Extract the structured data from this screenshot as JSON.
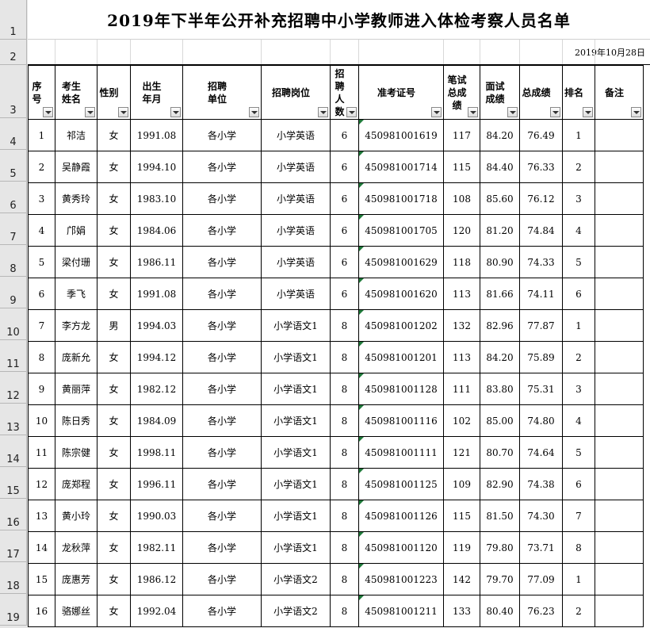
{
  "title": "2019年下半年公开补充招聘中小学教师进入体检考察人员名单",
  "date": "2019年10月28日",
  "row_numbers": [
    "1",
    "2",
    "3",
    "4",
    "5",
    "6",
    "7",
    "8",
    "9",
    "10",
    "11",
    "12",
    "13",
    "14",
    "15",
    "16",
    "17",
    "18",
    "19"
  ],
  "headers": [
    {
      "key": "seq",
      "label": "序\n号"
    },
    {
      "key": "name",
      "label": "考生\n姓名"
    },
    {
      "key": "gender",
      "label": "性别"
    },
    {
      "key": "birth",
      "label": "出生\n年月"
    },
    {
      "key": "unit",
      "label": "招聘\n单位"
    },
    {
      "key": "post",
      "label": "招聘岗位"
    },
    {
      "key": "count",
      "label": "招聘\n人数"
    },
    {
      "key": "exam_id",
      "label": "准考证号"
    },
    {
      "key": "written",
      "label": "笔试\n总成\n绩"
    },
    {
      "key": "interview",
      "label": "面试\n成绩"
    },
    {
      "key": "total",
      "label": "总成绩"
    },
    {
      "key": "rank",
      "label": "排名"
    },
    {
      "key": "note",
      "label": "备注"
    }
  ],
  "rows": [
    [
      "1",
      "祁洁",
      "女",
      "1991.08",
      "各小学",
      "小学英语",
      "6",
      "450981001619",
      "117",
      "84.20",
      "76.49",
      "1",
      ""
    ],
    [
      "2",
      "吴静霞",
      "女",
      "1994.10",
      "各小学",
      "小学英语",
      "6",
      "450981001714",
      "115",
      "84.40",
      "76.33",
      "2",
      ""
    ],
    [
      "3",
      "黄秀玲",
      "女",
      "1983.10",
      "各小学",
      "小学英语",
      "6",
      "450981001718",
      "108",
      "85.60",
      "76.12",
      "3",
      ""
    ],
    [
      "4",
      "邝娟",
      "女",
      "1984.06",
      "各小学",
      "小学英语",
      "6",
      "450981001705",
      "120",
      "81.20",
      "74.84",
      "4",
      ""
    ],
    [
      "5",
      "梁付珊",
      "女",
      "1986.11",
      "各小学",
      "小学英语",
      "6",
      "450981001629",
      "118",
      "80.90",
      "74.33",
      "5",
      ""
    ],
    [
      "6",
      "季飞",
      "女",
      "1991.08",
      "各小学",
      "小学英语",
      "6",
      "450981001620",
      "113",
      "81.66",
      "74.11",
      "6",
      ""
    ],
    [
      "7",
      "李方龙",
      "男",
      "1994.03",
      "各小学",
      "小学语文1",
      "8",
      "450981001202",
      "132",
      "82.96",
      "77.87",
      "1",
      ""
    ],
    [
      "8",
      "庞新允",
      "女",
      "1994.12",
      "各小学",
      "小学语文1",
      "8",
      "450981001201",
      "113",
      "84.20",
      "75.89",
      "2",
      ""
    ],
    [
      "9",
      "黄丽萍",
      "女",
      "1982.12",
      "各小学",
      "小学语文1",
      "8",
      "450981001128",
      "111",
      "83.80",
      "75.31",
      "3",
      ""
    ],
    [
      "10",
      "陈日秀",
      "女",
      "1984.09",
      "各小学",
      "小学语文1",
      "8",
      "450981001116",
      "102",
      "85.00",
      "74.80",
      "4",
      ""
    ],
    [
      "11",
      "陈宗健",
      "女",
      "1998.11",
      "各小学",
      "小学语文1",
      "8",
      "450981001111",
      "121",
      "80.70",
      "74.64",
      "5",
      ""
    ],
    [
      "12",
      "庞郑程",
      "女",
      "1996.11",
      "各小学",
      "小学语文1",
      "8",
      "450981001125",
      "109",
      "82.90",
      "74.38",
      "6",
      ""
    ],
    [
      "13",
      "黄小玲",
      "女",
      "1990.03",
      "各小学",
      "小学语文1",
      "8",
      "450981001126",
      "115",
      "81.50",
      "74.30",
      "7",
      ""
    ],
    [
      "14",
      "龙秋萍",
      "女",
      "1982.11",
      "各小学",
      "小学语文1",
      "8",
      "450981001120",
      "119",
      "79.80",
      "73.71",
      "8",
      ""
    ],
    [
      "15",
      "庞惠芳",
      "女",
      "1986.12",
      "各小学",
      "小学语文2",
      "8",
      "450981001223",
      "142",
      "79.70",
      "77.09",
      "1",
      ""
    ],
    [
      "16",
      "骆娜丝",
      "女",
      "1992.04",
      "各小学",
      "小学语文2",
      "8",
      "450981001211",
      "133",
      "80.40",
      "76.23",
      "2",
      ""
    ]
  ]
}
